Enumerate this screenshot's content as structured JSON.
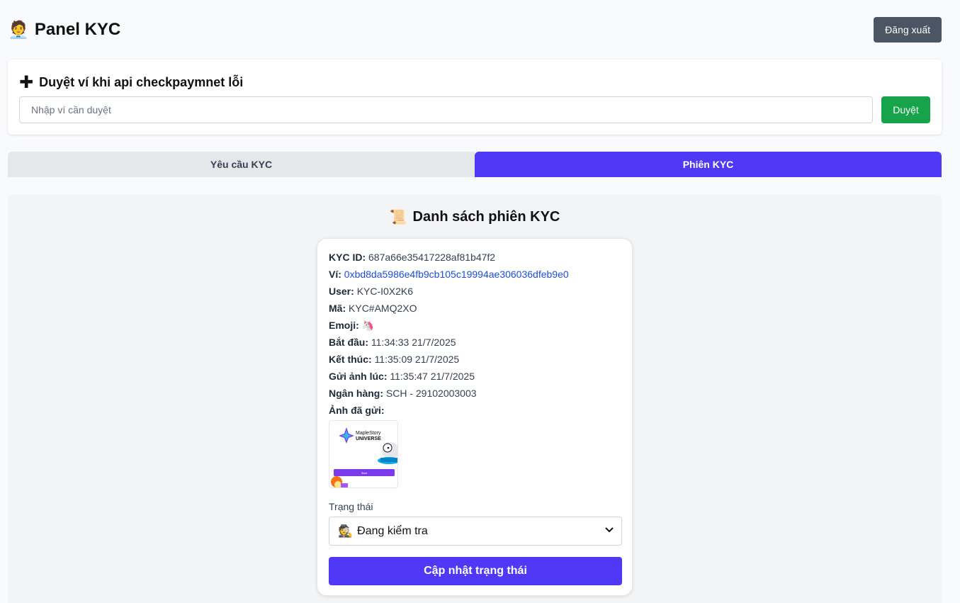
{
  "header": {
    "icon": "person-icon",
    "title": "Panel KYC",
    "logout_label": "Đăng xuất"
  },
  "approve": {
    "icon": "plus-icon",
    "title": "Duyệt ví khi api checkpaymnet lỗi",
    "placeholder": "Nhập ví cần duyệt",
    "value": "",
    "button_label": "Duyệt"
  },
  "tabs": [
    {
      "label": "Yêu cầu KYC",
      "active": false
    },
    {
      "label": "Phiên KYC",
      "active": true
    }
  ],
  "colors": {
    "accent": "#4f38f6",
    "success": "#16a34a",
    "logout": "#4b5563",
    "link": "#1d4ed8"
  },
  "sessions": {
    "icon": "scroll-icon",
    "title": "Danh sách phiên KYC",
    "card": {
      "kyc_id_label": "KYC ID:",
      "kyc_id": "687a66e35417228af81b47f2",
      "wallet_label": "Ví:",
      "wallet": "0xbd8da5986e4fb9cb105c19994ae306036dfeb9e0",
      "user_label": "User:",
      "user": "KYC-I0X2K6",
      "code_label": "Mã:",
      "code": "KYC#AMQ2XO",
      "emoji_label": "Emoji:",
      "emoji": "🦄",
      "start_label": "Bắt đầu:",
      "start": "11:34:33 21/7/2025",
      "end_label": "Kết thúc:",
      "end": "11:35:09 21/7/2025",
      "sent_label": "Gửi ảnh lúc:",
      "sent": "11:35:47 21/7/2025",
      "bank_label": "Ngân hàng:",
      "bank": "SCH - 29102003003",
      "image_label": "Ảnh đã gửi:",
      "image": {
        "logo_line1": "MapleStory",
        "logo_line2": "UNIVERSE",
        "button_text": "Start"
      },
      "status_label": "Trạng thái",
      "status_icon": "🕵",
      "status_value": "Đang kiểm tra",
      "update_label": "Cập nhật trạng thái"
    }
  }
}
